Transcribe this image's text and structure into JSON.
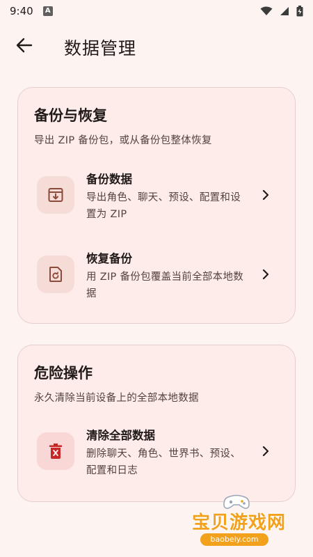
{
  "status_bar": {
    "time": "9:40",
    "notification_glyph": "A",
    "icons": [
      "wifi-icon",
      "signal-icon",
      "battery-icon"
    ]
  },
  "app_bar": {
    "title": "数据管理",
    "back_icon": "arrow-left-icon"
  },
  "backup_card": {
    "title": "备份与恢复",
    "subtitle": "导出 ZIP 备份包，或从备份包整体恢复",
    "items": [
      {
        "title": "备份数据",
        "desc": "导出角色、聊天、预设、配置和设置为 ZIP",
        "icon": "archive-download-icon"
      },
      {
        "title": "恢复备份",
        "desc": "用 ZIP 备份包覆盖当前全部本地数据",
        "icon": "file-restore-icon"
      }
    ]
  },
  "danger_card": {
    "title": "危险操作",
    "subtitle": "永久清除当前设备上的全部本地数据",
    "items": [
      {
        "title": "清除全部数据",
        "desc": "删除聊天、角色、世界书、预设、配置和日志",
        "icon": "delete-forever-icon"
      }
    ]
  },
  "watermark": {
    "text": "宝贝游戏网",
    "url": "baobeiy.com"
  },
  "colors": {
    "background": "#fdf4f2",
    "card": "#fdecea",
    "accent": "#8c4a3a",
    "danger": "#c62828"
  }
}
